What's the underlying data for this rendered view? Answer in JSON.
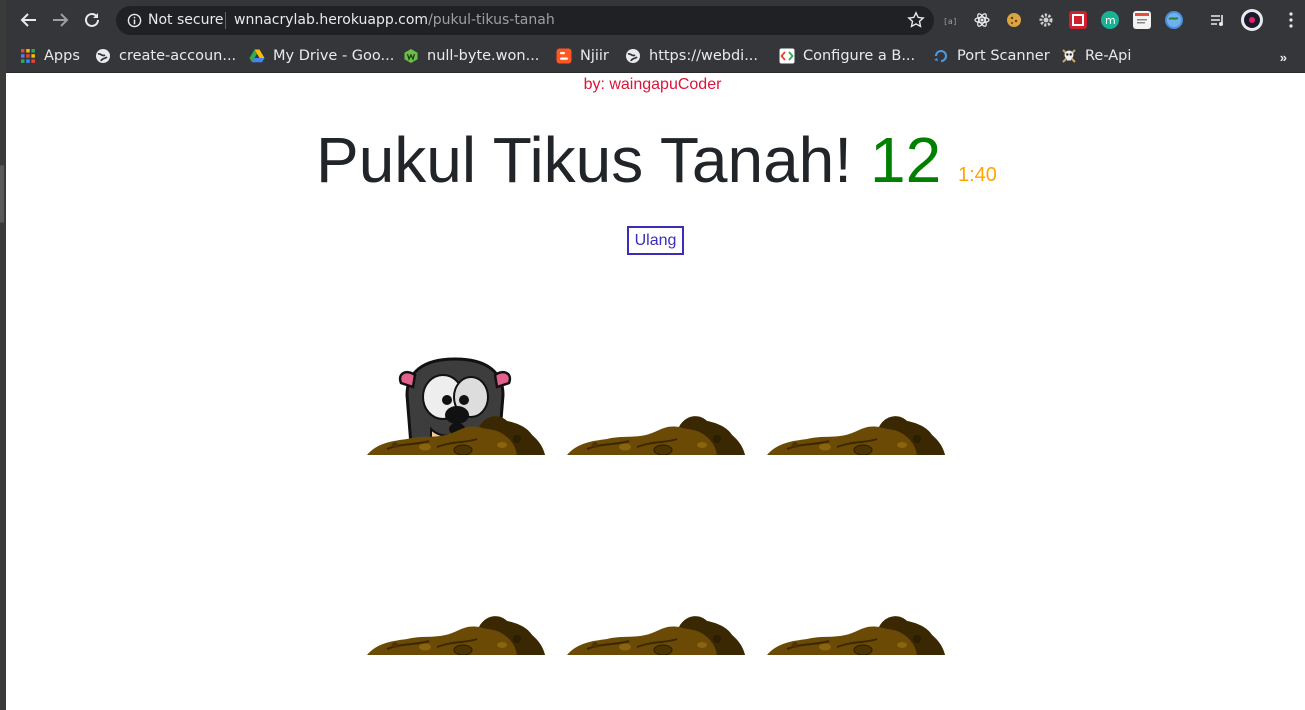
{
  "browser": {
    "security_label": "Not secure",
    "url_host": "wnnacrylab.herokuapp.com",
    "url_path": "/pukul-tikus-tanah",
    "bookmarks": [
      {
        "label": "Apps",
        "icon": "apps-grid-icon"
      },
      {
        "label": "create-accoun...",
        "icon": "globe-icon"
      },
      {
        "label": "My Drive - Goo...",
        "icon": "google-drive-icon"
      },
      {
        "label": "null-byte.won...",
        "icon": "wonderhowto-icon"
      },
      {
        "label": "Njiir",
        "icon": "blogger-icon"
      },
      {
        "label": "https://webdi...",
        "icon": "globe-icon"
      },
      {
        "label": "Configure a B...",
        "icon": "code-icon"
      },
      {
        "label": "Port Scanner",
        "icon": "port-scanner-icon"
      },
      {
        "label": "Re-Api",
        "icon": "skull-icon"
      }
    ],
    "more_label": "»"
  },
  "game": {
    "credit": "by: waingapuCoder",
    "title": "Pukul Tikus Tanah!",
    "score": "12",
    "timer": "1:40",
    "reset_label": "Ulang",
    "holes": [
      {
        "mole_up": true
      },
      {
        "mole_up": false
      },
      {
        "mole_up": false
      },
      {
        "mole_up": false
      },
      {
        "mole_up": false
      },
      {
        "mole_up": false
      }
    ]
  },
  "colors": {
    "credit": "#dc143c",
    "score": "#008000",
    "timer": "#ffa500",
    "button": "#3b2dbb",
    "dirt": "#6b4a06"
  }
}
